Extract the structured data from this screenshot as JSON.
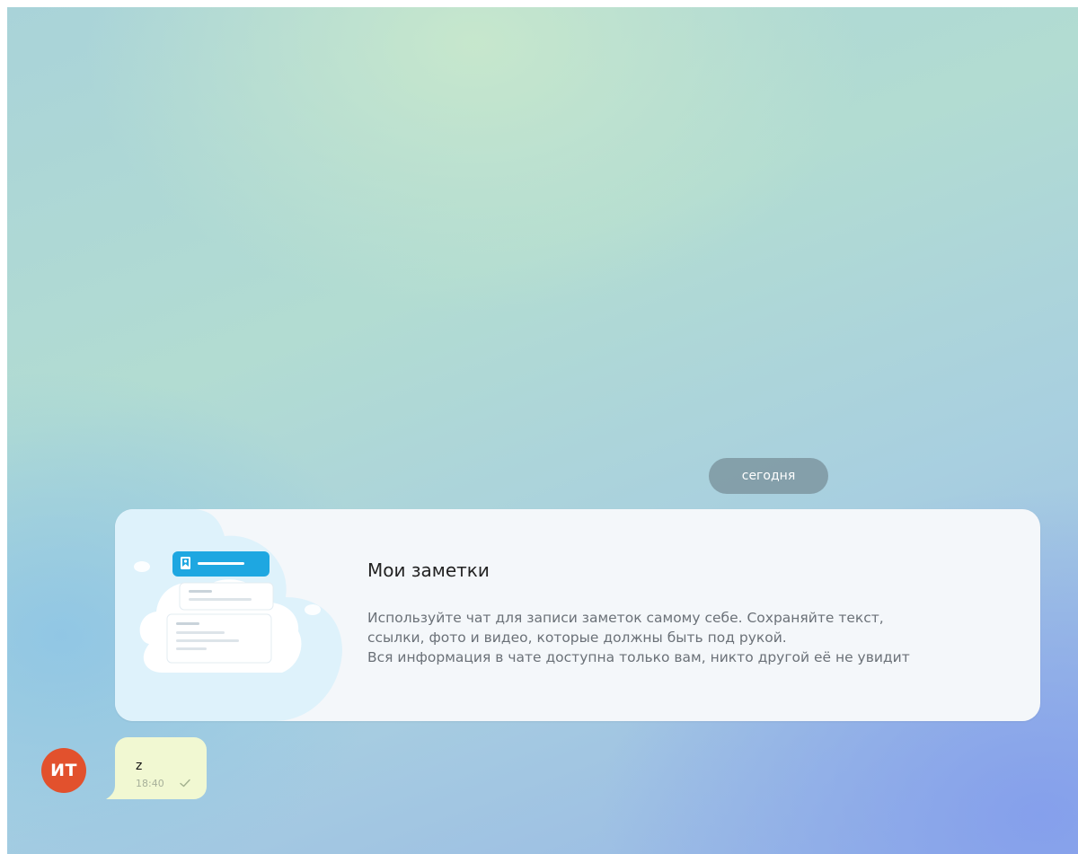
{
  "chat": {
    "date_separator": "сегодня",
    "intro": {
      "title": "Мои заметки",
      "lines": [
        "Используйте чат для записи заметок самому себе. Сохраняйте текст,",
        "ссылки, фото и видео, которые должны быть под рукой.",
        "Вся информация в чате доступна только вам, никто другой её не увидит"
      ],
      "illustration_icon": "notes-cloud-illustration"
    },
    "message": {
      "avatar_initials": "ИТ",
      "avatar_color": "#e2512d",
      "text": "z",
      "time": "18:40",
      "status_icon": "check-icon"
    }
  },
  "colors": {
    "bubble": "#f1f8d2",
    "card": "#f4f7fa",
    "accent": "#1ea7e1"
  }
}
